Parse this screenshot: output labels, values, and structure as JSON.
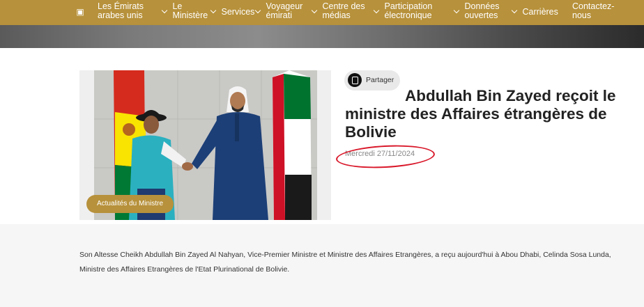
{
  "nav": {
    "home_icon": "home-icon",
    "items": [
      {
        "label": "Les Émirats arabes unis",
        "line1": "Les Émirats",
        "line2": "arabes unis"
      },
      {
        "label": "Le Ministère",
        "line1": "Le",
        "line2": "Ministère"
      },
      {
        "label": "Services"
      },
      {
        "label": "Voyageur émirati",
        "line1": "Voyageur",
        "line2": "émirati"
      },
      {
        "label": "Centre des médias",
        "line1": "Centre des",
        "line2": "médias"
      },
      {
        "label": "Participation électronique",
        "line1": "Participation",
        "line2": "électronique"
      },
      {
        "label": "Données ouvertes",
        "line1": "Données",
        "line2": "ouvertes"
      },
      {
        "label": "Carrières"
      },
      {
        "label": "Contactez-nous",
        "line1": "Contactez-",
        "line2": "nous"
      }
    ]
  },
  "article": {
    "category": "Actualités du Ministre",
    "share_label": "Partager",
    "title": "Abdullah Bin Zayed reçoit le ministre des Affaires étrangères de Bolivie",
    "date": "Mercredi 27/11/2024",
    "paragraph1": "Son Altesse Cheikh Abdullah Bin Zayed Al Nahyan, Vice-Premier Ministre et Ministre des Affaires Etrangères, a reçu aujourd'hui à Abou Dhabi, Celinda Sosa Lunda, Ministre des Affaires Etrangères de l'Etat Plurinational de Bolivie."
  },
  "colors": {
    "brand_gold": "#b7913b",
    "annotation_red": "#d9182a"
  }
}
